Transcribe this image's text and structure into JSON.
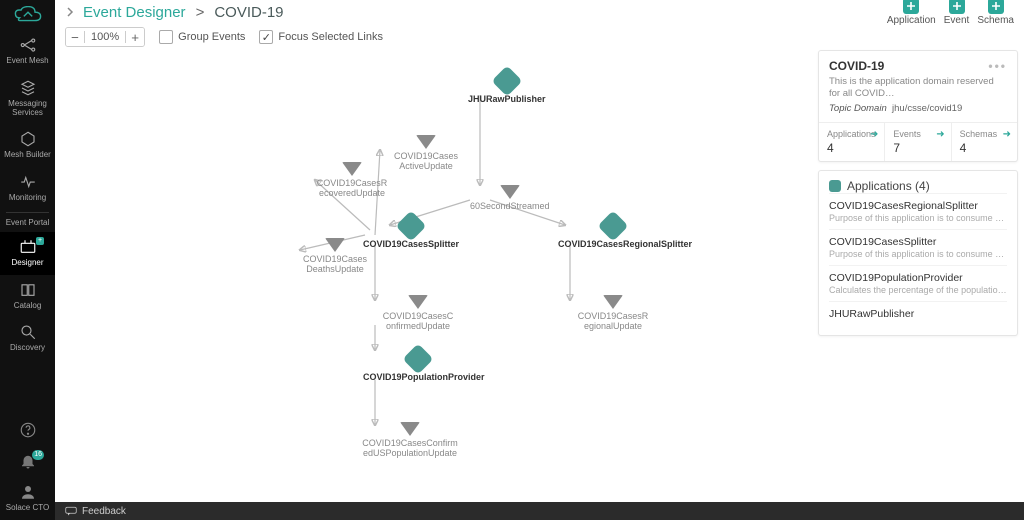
{
  "breadcrumb": {
    "root": "Event Designer",
    "current": "COVID-19"
  },
  "top_actions": {
    "application": "Application",
    "event": "Event",
    "schema": "Schema"
  },
  "toolbar": {
    "zoom": "100%",
    "group_label": "Group Events",
    "group_checked": false,
    "focus_label": "Focus Selected Links",
    "focus_checked": true
  },
  "sidebar": {
    "items": [
      {
        "id": "event-mesh",
        "label": "Event Mesh"
      },
      {
        "id": "messaging-services",
        "label": "Messaging Services"
      },
      {
        "id": "mesh-builder",
        "label": "Mesh Builder"
      },
      {
        "id": "monitoring",
        "label": "Monitoring"
      },
      {
        "id": "event-portal",
        "label": "Event Portal"
      },
      {
        "id": "designer",
        "label": "Designer"
      },
      {
        "id": "catalog",
        "label": "Catalog"
      },
      {
        "id": "discovery",
        "label": "Discovery"
      }
    ],
    "notification_count": "16",
    "user_label": "Solace CTO"
  },
  "footer": {
    "feedback": "Feedback"
  },
  "graph": {
    "apps": {
      "jhu": {
        "label": "JHURawPublisher"
      },
      "splitter": {
        "label": "COVID19CasesSplitter"
      },
      "regional": {
        "label": "COVID19CasesRegionalSplitter"
      },
      "pop": {
        "label": "COVID19PopulationProvider"
      }
    },
    "events": {
      "active": {
        "label": "COVID19Cases ActiveUpdate"
      },
      "recovered": {
        "label": "COVID19CasesR ecoveredUpdate"
      },
      "deaths": {
        "label": "COVID19Cases DeathsUpdate"
      },
      "stream": {
        "label": "60SecondStreamed"
      },
      "confirmed": {
        "label": "COVID19CasesC onfirmedUpdate"
      },
      "regupd": {
        "label": "COVID19CasesR egionalUpdate"
      },
      "uspop": {
        "label": "COVID19CasesConfirm edUSPopulationUpdate"
      }
    }
  },
  "info": {
    "title": "COVID-19",
    "desc": "This is the application domain reserved for all COVID…",
    "topic_domain_label": "Topic Domain",
    "topic_domain_value": "jhu/csse/covid19",
    "stats": {
      "applications": {
        "k": "Applications",
        "v": "4"
      },
      "events": {
        "k": "Events",
        "v": "7"
      },
      "schemas": {
        "k": "Schemas",
        "v": "4"
      }
    },
    "apps_header": "Applications (4)",
    "apps": [
      {
        "name": "COVID19CasesRegionalSplitter",
        "desc": "Purpose of this application is to consume RAW JHU …"
      },
      {
        "name": "COVID19CasesSplitter",
        "desc": "Purpose of this application is to consume RAW JHU …"
      },
      {
        "name": "COVID19PopulationProvider",
        "desc": "Calculates the percentage of the population that ha…"
      },
      {
        "name": "JHURawPublisher",
        "desc": ""
      }
    ]
  }
}
